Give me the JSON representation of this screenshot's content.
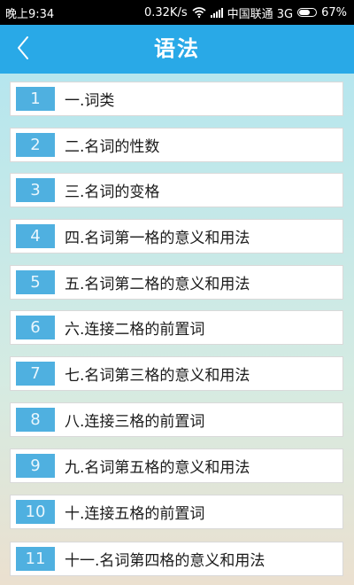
{
  "status_bar": {
    "time": "晚上9:34",
    "speed": "0.32K/s",
    "carrier": "中国联通 3G",
    "battery_percent": "67%",
    "battery_level": 0.67
  },
  "header": {
    "title": "语法",
    "back_icon": "chevron-left-icon"
  },
  "colors": {
    "header_bg": "#29a9e7",
    "number_badge_bg": "#4fb0e0"
  },
  "items": [
    {
      "num": "1",
      "label": "一.词类"
    },
    {
      "num": "2",
      "label": "二.名词的性数"
    },
    {
      "num": "3",
      "label": "三.名词的变格"
    },
    {
      "num": "4",
      "label": "四.名词第一格的意义和用法"
    },
    {
      "num": "5",
      "label": "五.名词第二格的意义和用法"
    },
    {
      "num": "6",
      "label": "六.连接二格的前置词"
    },
    {
      "num": "7",
      "label": "七.名词第三格的意义和用法"
    },
    {
      "num": "8",
      "label": "八.连接三格的前置词"
    },
    {
      "num": "9",
      "label": "九.名词第五格的意义和用法"
    },
    {
      "num": "10",
      "label": "十.连接五格的前置词"
    },
    {
      "num": "11",
      "label": "十一.名词第四格的意义和用法"
    }
  ]
}
